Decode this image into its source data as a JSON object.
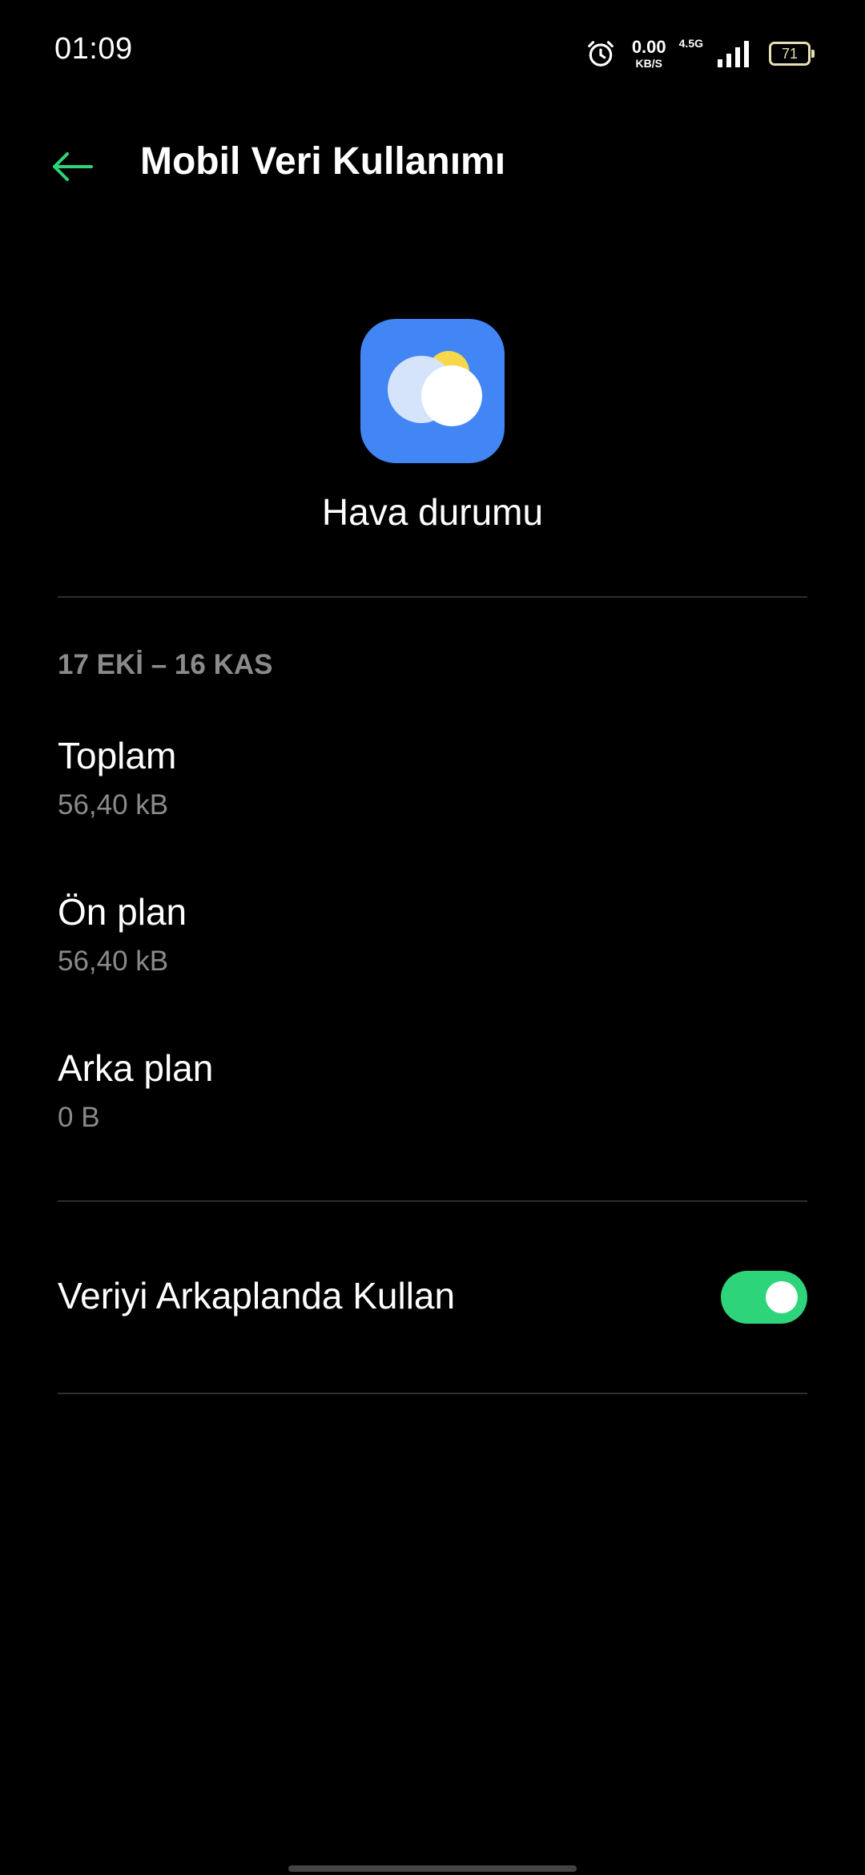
{
  "status_bar": {
    "time": "01:09",
    "net_speed_value": "0.00",
    "net_speed_unit": "KB/S",
    "network_type": "4.5G",
    "battery_level": "71",
    "icons": [
      "alarm-icon",
      "signal-icon",
      "battery-icon"
    ]
  },
  "header": {
    "title": "Mobil Veri Kullanımı",
    "back_icon": "arrow-left-icon"
  },
  "app": {
    "name": "Hava durumu",
    "icon": "weather-app-icon"
  },
  "usage": {
    "period": "17 EKİ – 16 KAS",
    "items": [
      {
        "label": "Toplam",
        "value": "56,40 kB"
      },
      {
        "label": "Ön plan",
        "value": "56,40 kB"
      },
      {
        "label": "Arka plan",
        "value": "0 B"
      }
    ]
  },
  "background_data": {
    "label": "Veriyi Arkaplanda Kullan",
    "enabled": true
  },
  "colors": {
    "background": "#000000",
    "accent_green": "#2ed47a",
    "app_icon_blue": "#4285f4",
    "secondary_text": "#8a8a8a",
    "divider": "#2e2e2e"
  }
}
